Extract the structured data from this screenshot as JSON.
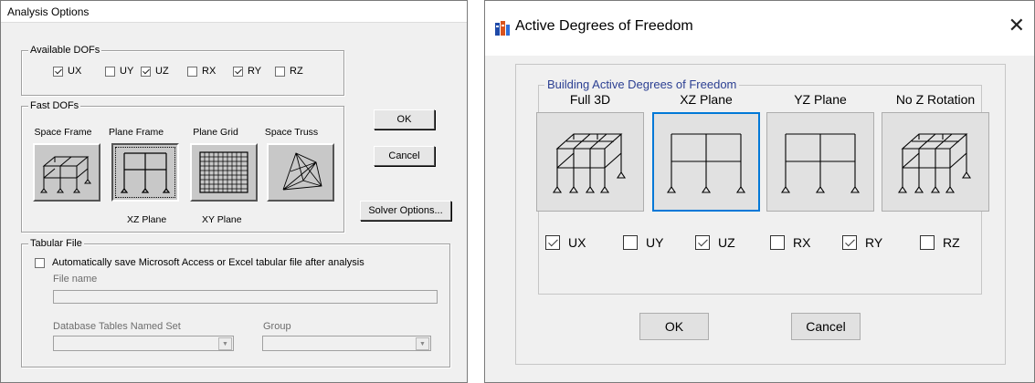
{
  "left": {
    "title": "Analysis Options",
    "available": {
      "label": "Available DOFs",
      "items": [
        {
          "label": "UX",
          "checked": true
        },
        {
          "label": "UY",
          "checked": false
        },
        {
          "label": "UZ",
          "checked": true
        },
        {
          "label": "RX",
          "checked": false
        },
        {
          "label": "RY",
          "checked": true
        },
        {
          "label": "RZ",
          "checked": false
        }
      ]
    },
    "fast": {
      "label": "Fast DOFs",
      "buttons": [
        {
          "label": "Space Frame",
          "icon": "space-frame-icon",
          "selected": false
        },
        {
          "label": "Plane Frame",
          "icon": "plane-frame-icon",
          "selected": true
        },
        {
          "label": "Plane Grid",
          "icon": "plane-grid-icon",
          "selected": false
        },
        {
          "label": "Space Truss",
          "icon": "space-truss-icon",
          "selected": false
        }
      ],
      "sub_labels": [
        "XZ Plane",
        "XY Plane"
      ]
    },
    "buttons": {
      "ok": "OK",
      "cancel": "Cancel",
      "solver": "Solver Options..."
    },
    "tabular": {
      "label": "Tabular File",
      "auto_save": "Automatically save Microsoft Access or Excel tabular file after analysis",
      "auto_save_checked": false,
      "file_name_label": "File name",
      "file_name_value": "",
      "db_tables_label": "Database Tables Named Set",
      "db_tables_value": "",
      "group_label": "Group",
      "group_value": ""
    }
  },
  "right": {
    "title": "Active Degrees of Freedom",
    "group_label": "Building Active Degrees of Freedom",
    "options": [
      {
        "label": "Full 3D",
        "icon": "full-3d-icon",
        "selected": false
      },
      {
        "label": "XZ Plane",
        "icon": "xz-plane-icon",
        "selected": true
      },
      {
        "label": "YZ Plane",
        "icon": "yz-plane-icon",
        "selected": false
      },
      {
        "label": "No Z Rotation",
        "icon": "no-z-rotation-icon",
        "selected": false
      }
    ],
    "dofs": [
      {
        "label": "UX",
        "checked": true
      },
      {
        "label": "UY",
        "checked": false
      },
      {
        "label": "UZ",
        "checked": true
      },
      {
        "label": "RX",
        "checked": false
      },
      {
        "label": "RY",
        "checked": true
      },
      {
        "label": "RZ",
        "checked": false
      }
    ],
    "buttons": {
      "ok": "OK",
      "cancel": "Cancel"
    },
    "close_icon": "close-icon",
    "app_icon": "app-icon",
    "accent": "#0078d7",
    "group_label_color": "#2b3f92"
  }
}
